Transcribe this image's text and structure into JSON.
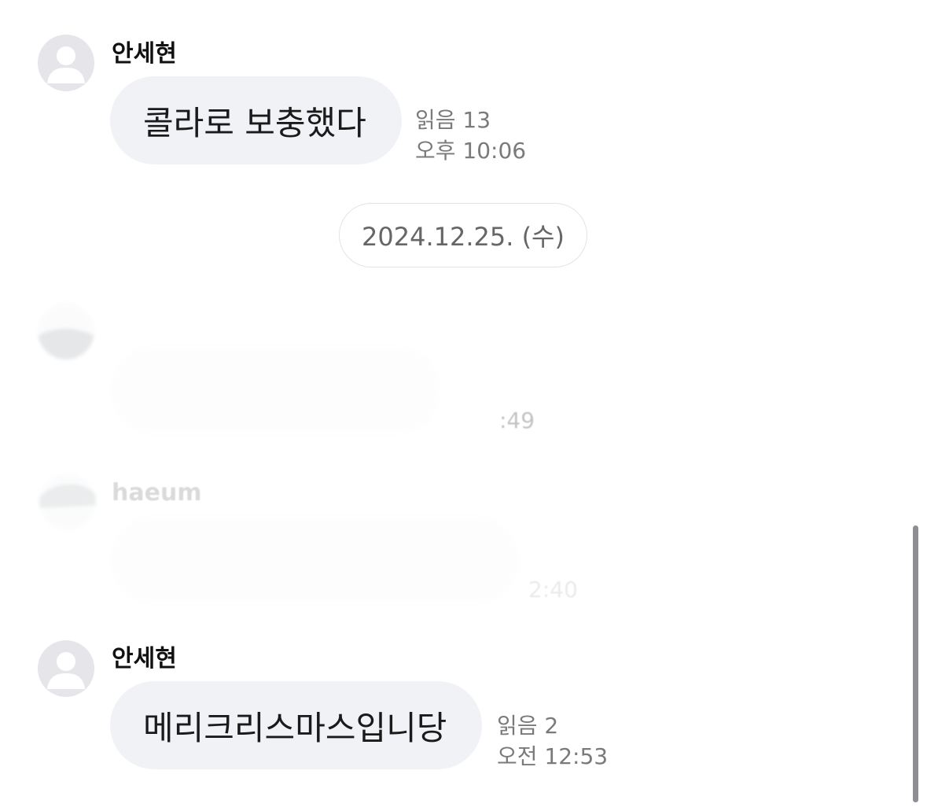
{
  "messages": [
    {
      "sender": "안세현",
      "avatar_icon": "default-person-icon",
      "text": "콜라로 보충했다",
      "read_count": "읽음 13",
      "time": "오후 10:06"
    },
    {
      "sender": "안세현",
      "avatar_icon": "default-person-icon",
      "text": "메리크리스마스입니당",
      "read_count": "읽음 2",
      "time": "오전 12:53"
    }
  ],
  "date_separator": "2024.12.25. (수)",
  "obscured": [
    {
      "sender": "",
      "time_fragment": ":49",
      "avatar_icon": "photo-avatar-icon"
    },
    {
      "sender": "haeum",
      "time_fragment": "2:40",
      "avatar_icon": "photo-avatar-icon"
    }
  ],
  "colors": {
    "bubble_bg": "#f1f2f6",
    "meta_text": "#7a7a7a",
    "avatar_bg": "#e6e6ea",
    "scrollbar": "#8e8e93"
  }
}
